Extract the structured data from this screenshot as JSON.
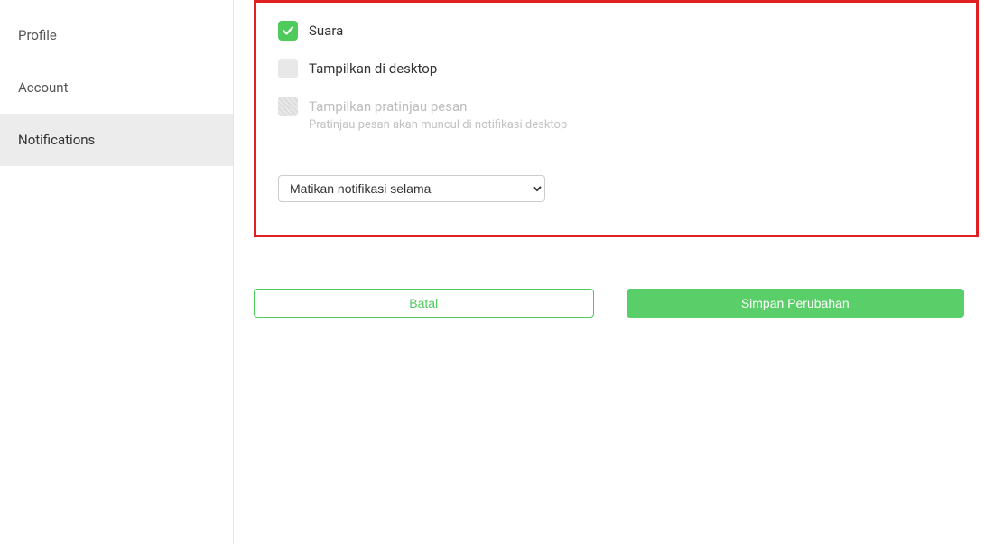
{
  "sidebar": {
    "items": [
      {
        "label": "Profile",
        "active": false
      },
      {
        "label": "Account",
        "active": false
      },
      {
        "label": "Notifications",
        "active": true
      }
    ]
  },
  "settings": {
    "sound": {
      "label": "Suara",
      "checked": true
    },
    "desktop": {
      "label": "Tampilkan di desktop",
      "checked": false
    },
    "preview": {
      "label": "Tampilkan pratinjau pesan",
      "sublabel": "Pratinjau pesan akan muncul di notifikasi desktop",
      "disabled": true
    },
    "mute": {
      "selected": "Matikan notifikasi selama"
    }
  },
  "buttons": {
    "cancel": "Batal",
    "save": "Simpan Perubahan"
  },
  "colors": {
    "accent": "#4ecb5c",
    "highlight": "#e02020"
  }
}
